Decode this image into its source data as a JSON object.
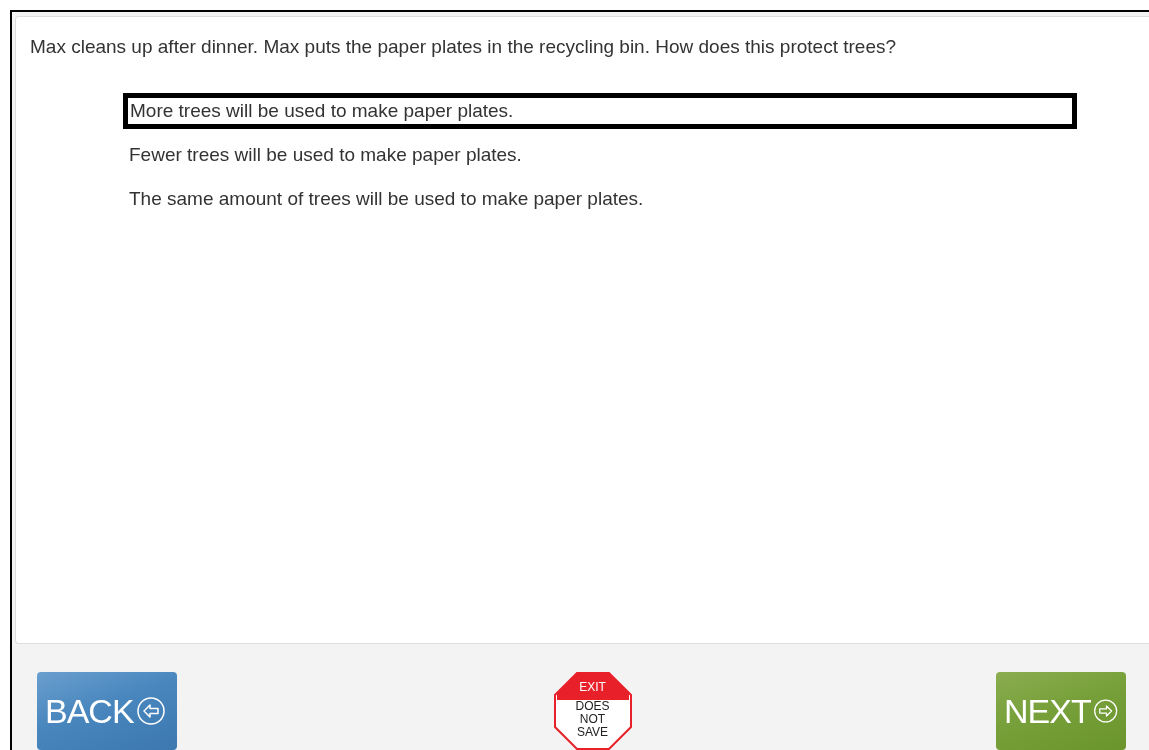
{
  "question": "Max cleans up after dinner. Max puts the paper plates in the recycling bin. How does this protect trees?",
  "options": [
    {
      "label": "More trees will be used to make paper plates.",
      "selected": true
    },
    {
      "label": "Fewer trees will be used to make paper plates.",
      "selected": false
    },
    {
      "label": "The same amount of trees will be used to make paper plates.",
      "selected": false
    }
  ],
  "footer": {
    "back": "BACK",
    "exit_top": "EXIT",
    "exit_lines": [
      "DOES",
      "NOT",
      "SAVE"
    ],
    "next": "NEXT"
  }
}
